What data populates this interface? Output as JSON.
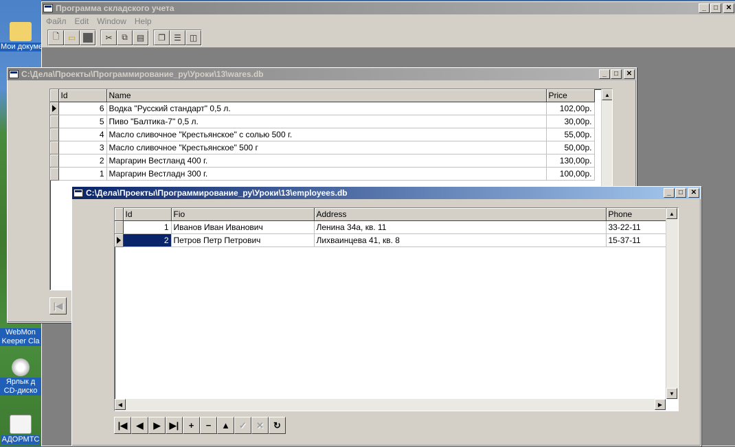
{
  "desktop": {
    "icons": [
      {
        "label": "Мои докумен"
      },
      {
        "label": "WebMon Keeper Cla"
      },
      {
        "label": "Ярлык д CD-диско"
      },
      {
        "label": "АДОРМТС"
      }
    ]
  },
  "main_window": {
    "title": "Программа складского учета",
    "menu": [
      "Файл",
      "Edit",
      "Window",
      "Help"
    ],
    "toolbar": {
      "groups": [
        [
          "new-icon",
          "open-icon",
          "save-icon"
        ],
        [
          "cut-icon",
          "copy-icon",
          "paste-icon"
        ],
        [
          "cascade-icon",
          "tile-horizontal-icon",
          "tile-vertical-icon"
        ]
      ]
    }
  },
  "wares_window": {
    "title": "C:\\Дела\\Проекты\\Программирование_ру\\Уроки\\13\\wares.db",
    "columns": [
      "Id",
      "Name",
      "Price"
    ],
    "rows": [
      {
        "id": "6",
        "name": "Водка \"Русский стандарт\" 0,5 л.",
        "price": "102,00р."
      },
      {
        "id": "5",
        "name": "Пиво \"Балтика-7\"   0,5 л.",
        "price": "30,00р."
      },
      {
        "id": "4",
        "name": "Масло сливочное \"Крестьянское\" с солью 500 г.",
        "price": "55,00р."
      },
      {
        "id": "3",
        "name": "Масло сливочное \"Крестьянское\" 500 г",
        "price": "50,00р."
      },
      {
        "id": "2",
        "name": "Маргарин Вестланд 400 г.",
        "price": "130,00р."
      },
      {
        "id": "1",
        "name": "Маргарин Вестладн 300 г.",
        "price": "100,00р."
      }
    ]
  },
  "employees_window": {
    "title": "C:\\Дела\\Проекты\\Программирование_ру\\Уроки\\13\\employees.db",
    "columns": [
      "Id",
      "Fio",
      "Address",
      "Phone"
    ],
    "rows": [
      {
        "id": "1",
        "fio": "Иванов Иван Иванович",
        "address": "Ленина 34а, кв. 11",
        "phone": "33-22-11"
      },
      {
        "id": "2",
        "fio": "Петров Петр Петрович",
        "address": "Лихваинцева 41, кв. 8",
        "phone": "15-37-11"
      }
    ],
    "selected_row": 1,
    "navigator": [
      {
        "name": "nav-first-button",
        "glyph": "|◀",
        "enabled": true
      },
      {
        "name": "nav-prior-button",
        "glyph": "◀",
        "enabled": true
      },
      {
        "name": "nav-next-button",
        "glyph": "▶",
        "enabled": true
      },
      {
        "name": "nav-last-button",
        "glyph": "▶|",
        "enabled": true
      },
      {
        "name": "nav-insert-button",
        "glyph": "+",
        "enabled": true
      },
      {
        "name": "nav-delete-button",
        "glyph": "−",
        "enabled": true
      },
      {
        "name": "nav-edit-button",
        "glyph": "▲",
        "enabled": true
      },
      {
        "name": "nav-post-button",
        "glyph": "✓",
        "enabled": false
      },
      {
        "name": "nav-cancel-button",
        "glyph": "✕",
        "enabled": false
      },
      {
        "name": "nav-refresh-button",
        "glyph": "↻",
        "enabled": true
      }
    ]
  }
}
